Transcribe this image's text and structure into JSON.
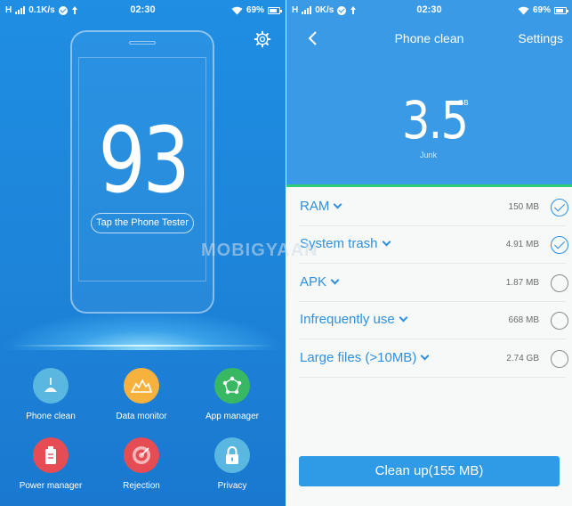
{
  "left_screen": {
    "status_bar": {
      "signal": "H",
      "net_speed": "0.1K/s",
      "time": "02:30",
      "battery": "69%"
    },
    "score": "93",
    "tester_button_label": "Tap the Phone Tester",
    "features": [
      {
        "label": "Phone clean",
        "icon": "broom-icon",
        "color": "#5ab7e0"
      },
      {
        "label": "Data monitor",
        "icon": "mountain-chart-icon",
        "color": "#f6b23d"
      },
      {
        "label": "App manager",
        "icon": "network-nodes-icon",
        "color": "#39b864"
      },
      {
        "label": "Power manager",
        "icon": "battery-icon",
        "color": "#e64c53"
      },
      {
        "label": "Rejection",
        "icon": "target-icon",
        "color": "#e64c53"
      },
      {
        "label": "Privacy",
        "icon": "lock-icon",
        "color": "#5ab7e0"
      }
    ]
  },
  "right_screen": {
    "status_bar": {
      "signal": "H",
      "net_speed": "0K/s",
      "time": "02:30",
      "battery": "69%"
    },
    "header": {
      "title": "Phone clean",
      "settings_label": "Settings"
    },
    "junk": {
      "size": "3.5",
      "unit": "GB",
      "label": "Junk"
    },
    "items": [
      {
        "name": "RAM",
        "size": "150 MB",
        "checked": true
      },
      {
        "name": "System trash",
        "size": "4.91 MB",
        "checked": true
      },
      {
        "name": "APK",
        "size": "1.87 MB",
        "checked": false
      },
      {
        "name": "Infrequently use",
        "size": "668 MB",
        "checked": false
      },
      {
        "name": "Large files (>10MB)",
        "size": "2.74 GB",
        "checked": false
      }
    ],
    "clean_button_label": "Clean up(155 MB)"
  },
  "watermark": "MOBIGYAAN",
  "colors": {
    "left_bg": "#1f8ee3",
    "right_header_bg": "#3a9ae6",
    "accent_blue": "#2e90de",
    "progress_green": "#2fcc78"
  }
}
